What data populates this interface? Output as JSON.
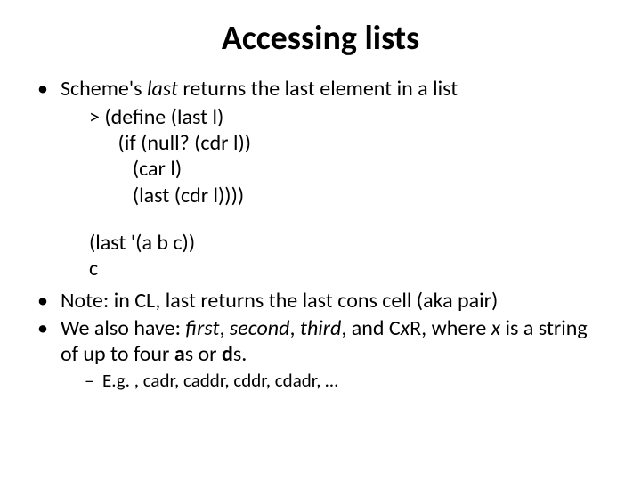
{
  "title": "Accessing lists",
  "bullet1_pre": "Scheme's ",
  "bullet1_ital": "last",
  "bullet1_post": " returns the last element in a list",
  "code1": "> (define (last l)",
  "code2": "      (if (null? (cdr l))",
  "code3": "         (car l)",
  "code4": "         (last (cdr l))))",
  "code5": "(last  '(a  b  c))",
  "code6": "c",
  "bullet2": "Note: in CL, last returns the last cons cell (aka pair)",
  "bullet3_a": "We also have: ",
  "bullet3_first": "first",
  "bullet3_c1": ", ",
  "bullet3_second": "second",
  "bullet3_c2": ", ",
  "bullet3_third": "third",
  "bullet3_c3": ", and C",
  "bullet3_x": "x",
  "bullet3_d": "R, where ",
  "bullet3_x2": "x",
  "bullet3_e": " is a string of up to four ",
  "bullet3_a1": "a",
  "bullet3_f": "s or ",
  "bullet3_d1": "d",
  "bullet3_g": "s.",
  "sub1": "E.g. , cadr, caddr, cddr, cdadr, …",
  "dot": "•",
  "dash": "–"
}
